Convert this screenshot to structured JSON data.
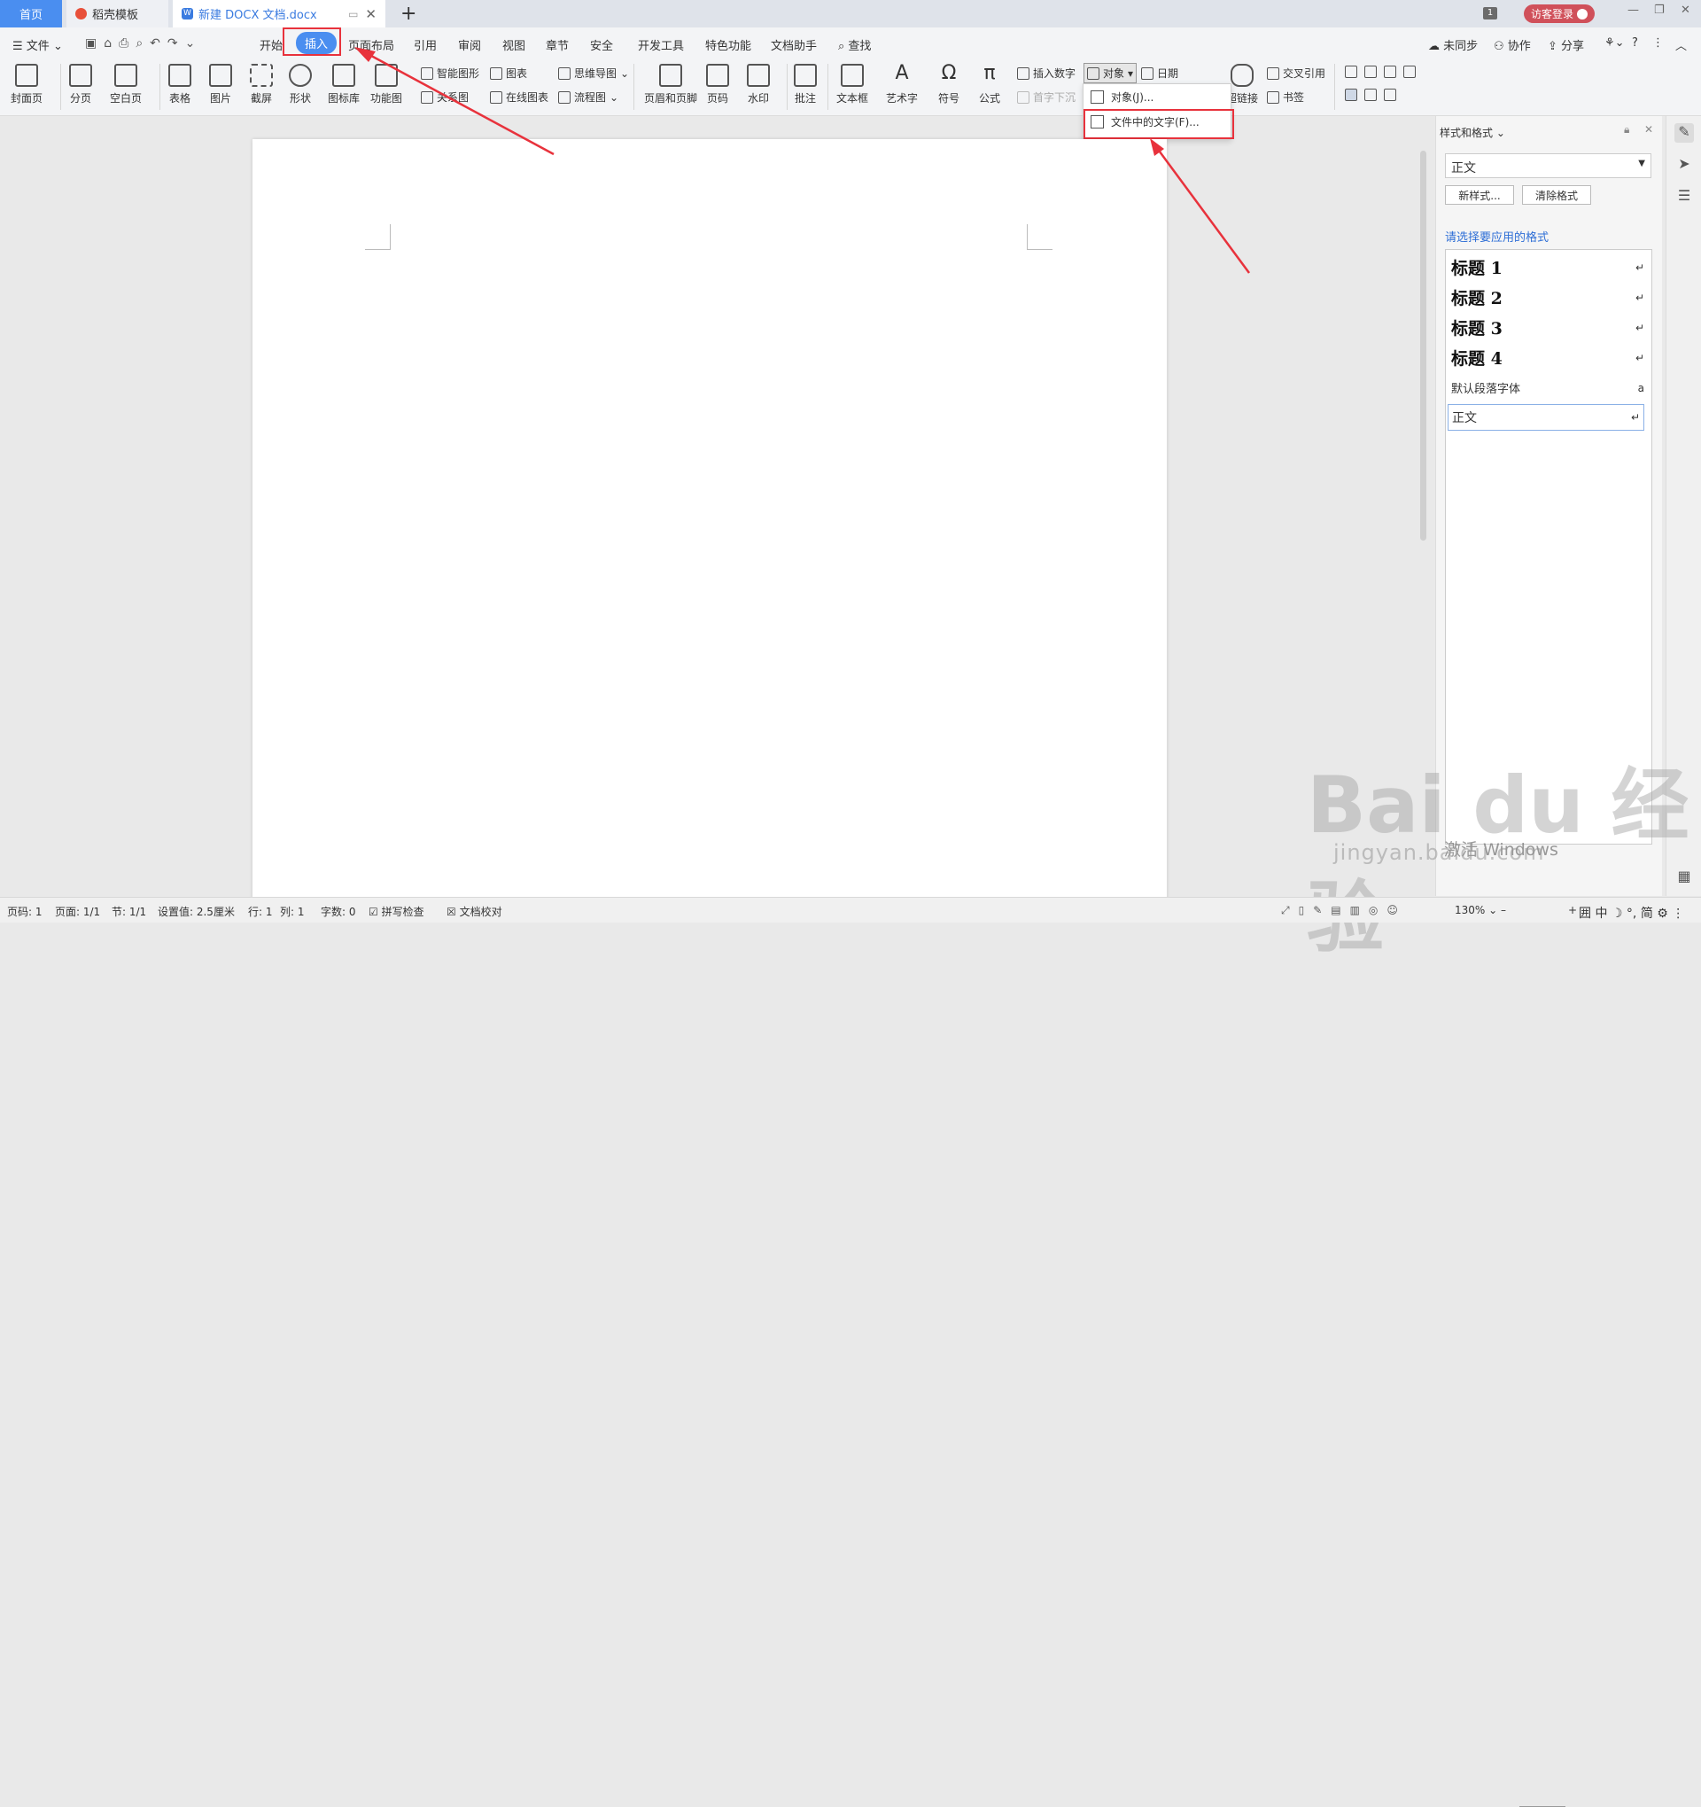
{
  "titlebar": {
    "tabs": [
      {
        "label": "首页"
      },
      {
        "label": "稻壳模板"
      },
      {
        "label": "新建 DOCX 文档.docx"
      }
    ],
    "badge": "1",
    "login": "访客登录"
  },
  "menubar": {
    "file": "文件",
    "items": [
      "开始",
      "插入",
      "页面布局",
      "引用",
      "审阅",
      "视图",
      "章节",
      "安全",
      "开发工具",
      "特色功能",
      "文档助手"
    ],
    "search": "查找",
    "right": [
      "未同步",
      "协作",
      "分享"
    ]
  },
  "ribbon": {
    "big": [
      "封面页",
      "分页",
      "空白页",
      "表格",
      "图片",
      "截屏",
      "形状",
      "图标库",
      "功能图",
      "页眉和页脚",
      "页码",
      "水印",
      "批注",
      "文本框",
      "艺术字",
      "符号",
      "公式",
      "超链接"
    ],
    "small": [
      "智能图形",
      "图表",
      "思维导图",
      "关系图",
      "在线图表",
      "流程图",
      "插入数字",
      "对象",
      "日期",
      "首字下沉",
      "交叉引用",
      "书签"
    ]
  },
  "dropdown": {
    "items": [
      "对象(J)...",
      "文件中的文字(F)..."
    ]
  },
  "panel": {
    "title": "样式和格式",
    "current_style": "正文",
    "new_style": "新样式...",
    "clear_format": "清除格式",
    "apply_label": "请选择要应用的格式",
    "styles": [
      {
        "name": "标题  1",
        "mark": "↵"
      },
      {
        "name": "标题  2",
        "mark": "↵"
      },
      {
        "name": "标题  3",
        "mark": "↵"
      },
      {
        "name": "标题 4",
        "mark": "↵"
      },
      {
        "name": "默认段落字体",
        "mark": "a"
      },
      {
        "name": "正文",
        "mark": "↵"
      }
    ]
  },
  "statusbar": {
    "page": "页码: 1",
    "pages": "页面: 1/1",
    "section": "节: 1/1",
    "setting": "设置值: 2.5厘米",
    "row": "行: 1",
    "col": "列: 1",
    "words": "字数: 0",
    "spell": "拼写检查",
    "proof": "文档校对",
    "zoom": "130%",
    "ime": "中",
    "ime2": "简"
  },
  "watermark": {
    "logo": "Bai du 经验",
    "site": "jingyan.baidu.com",
    "activate": "激活 Windows"
  },
  "colors": {
    "accent": "#4a8ef0",
    "highlight": "#e8323c",
    "login": "#d0505a"
  }
}
